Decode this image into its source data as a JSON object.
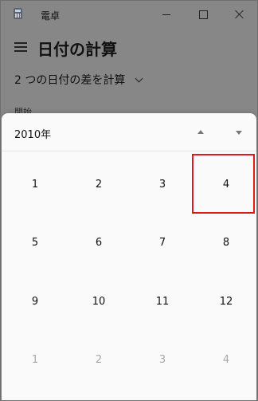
{
  "window": {
    "title": "電卓",
    "app_icon": "calculator-icon",
    "controls": [
      "minimize-icon",
      "maximize-icon",
      "close-icon"
    ]
  },
  "header": {
    "nav_icon": "hamburger-menu-icon",
    "page_title": "日付の計算"
  },
  "mode": {
    "selected": "2 つの日付の差を計算",
    "icon": "chevron-down-icon"
  },
  "from_label": "開始",
  "picker": {
    "year": "2010年",
    "prev_icon": "caret-up-icon",
    "next_icon": "caret-down-icon",
    "months": [
      {
        "label": "1"
      },
      {
        "label": "2"
      },
      {
        "label": "3"
      },
      {
        "label": "4"
      },
      {
        "label": "5"
      },
      {
        "label": "6"
      },
      {
        "label": "7"
      },
      {
        "label": "8"
      },
      {
        "label": "9"
      },
      {
        "label": "10"
      },
      {
        "label": "11"
      },
      {
        "label": "12"
      },
      {
        "label": "1"
      },
      {
        "label": "2"
      },
      {
        "label": "3"
      },
      {
        "label": "4"
      }
    ]
  },
  "colors": {
    "overlay_bg": "#878787",
    "picker_bg": "#fafafa",
    "highlight": "#e01818",
    "dim_text": "#a7a7a7"
  }
}
